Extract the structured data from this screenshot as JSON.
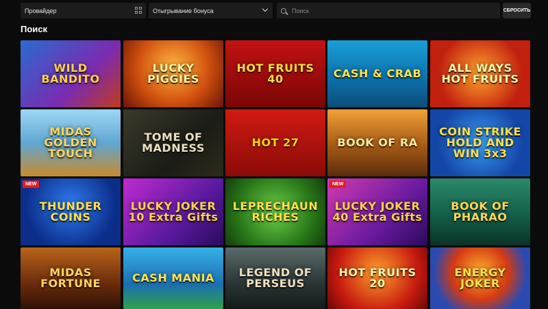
{
  "filters": {
    "provider_label": "Провайдер",
    "bonus_label": "Отыгрывание бонуса",
    "search_placeholder": "Поиск",
    "reset_label": "СБРОСИТЬ"
  },
  "page": {
    "title": "Поиск"
  },
  "colors": {
    "background": "#0b0b0b",
    "field": "#1c1c1c",
    "badge": "#e41b23"
  },
  "games": [
    {
      "name": "WILD BANDITO",
      "badge": "",
      "bg": "linear-gradient(135deg,#2a6bd1,#7a2bb0 60%,#c23a1c)",
      "color": "#ffd24a"
    },
    {
      "name": "LUCKY PIGGIES",
      "badge": "",
      "bg": "radial-gradient(circle at 50% 40%,#ffb640,#d1510e 55%,#6a1406)",
      "color": "#fff2a0"
    },
    {
      "name": "HOT FRUITS 40",
      "badge": "",
      "bg": "linear-gradient(180deg,#c21212,#7a0606)",
      "color": "#ffdb3a"
    },
    {
      "name": "CASH & CRAB",
      "badge": "",
      "bg": "linear-gradient(180deg,#1a9ed8,#0b6ea8 60%,#0d4d7a)",
      "color": "#ffe14a"
    },
    {
      "name": "ALL WAYS HOT FRUITS",
      "badge": "",
      "bg": "radial-gradient(circle at 50% 50%,#ffa42a,#c1200f 70%)",
      "color": "#fff3a8"
    },
    {
      "name": "MIDAS GOLDEN TOUCH",
      "badge": "",
      "bg": "linear-gradient(180deg,#9ed7f4,#5fa7d3 50%,#c88a2a)",
      "color": "#ffd65a"
    },
    {
      "name": "TOME OF MADNESS",
      "badge": "",
      "bg": "linear-gradient(135deg,#3a3a2a,#1a1c16 60%,#2e2a1a)",
      "color": "#e8e0c0"
    },
    {
      "name": "HOT 27",
      "badge": "",
      "bg": "linear-gradient(180deg,#d11a12,#8a0b08)",
      "color": "#ffd400"
    },
    {
      "name": "BOOK OF RA",
      "badge": "",
      "bg": "linear-gradient(180deg,#f0a038,#a45a14 55%,#5a2c0c)",
      "color": "#ffe9a0"
    },
    {
      "name": "COIN STRIKE HOLD AND WIN 3x3",
      "badge": "",
      "bg": "radial-gradient(circle at 50% 50%,#3a9cf0,#1446a8 70%)",
      "color": "#ffe14a"
    },
    {
      "name": "THUNDER COINS",
      "badge": "NEW",
      "bg": "radial-gradient(circle at 50% 40%,#2f7cf0,#0c2e8a 70%)",
      "color": "#ffe14a"
    },
    {
      "name": "LUCKY JOKER 10 Extra Gifts",
      "badge": "",
      "bg": "linear-gradient(135deg,#c02ad0,#5a1aa0 60%,#2a0a5a)",
      "color": "#ffd24a"
    },
    {
      "name": "LEPRECHAUN RICHES",
      "badge": "",
      "bg": "radial-gradient(circle at 50% 50%,#6ed04a,#2a7a1a 60%,#143d0c)",
      "color": "#ffe14a"
    },
    {
      "name": "LUCKY JOKER 40 Extra Gifts",
      "badge": "NEW",
      "bg": "linear-gradient(135deg,#d23ab0,#6a1aa0 60%,#2a0a5a)",
      "color": "#ffd24a"
    },
    {
      "name": "BOOK OF PHARAO",
      "badge": "",
      "bg": "linear-gradient(180deg,#2a8a6a,#135a44 60%,#0a3226)",
      "color": "#ffd65a"
    },
    {
      "name": "MIDAS FORTUNE",
      "badge": "",
      "bg": "linear-gradient(180deg,#b8641a,#6a2a0a 60%,#2e1206)",
      "color": "#ffd65a"
    },
    {
      "name": "CASH MANIA",
      "badge": "",
      "bg": "linear-gradient(180deg,#36b0e8,#1c6fb0 60%,#2ea04a)",
      "color": "#ffe14a"
    },
    {
      "name": "LEGEND OF PERSEUS",
      "badge": "",
      "bg": "linear-gradient(180deg,#5a6a6a,#2a3434 60%,#141a1a)",
      "color": "#f0e0c0"
    },
    {
      "name": "HOT FRUITS 20",
      "badge": "",
      "bg": "radial-gradient(circle at 50% 40%,#ffa02a,#c71a10 65%,#6a0606)",
      "color": "#fff3a8"
    },
    {
      "name": "ENERGY JOKER",
      "badge": "",
      "bg": "radial-gradient(circle at 50% 40%,#ffb02a,#d43a14 45%,#2a4ab0 75%)",
      "color": "#ffe14a"
    }
  ]
}
